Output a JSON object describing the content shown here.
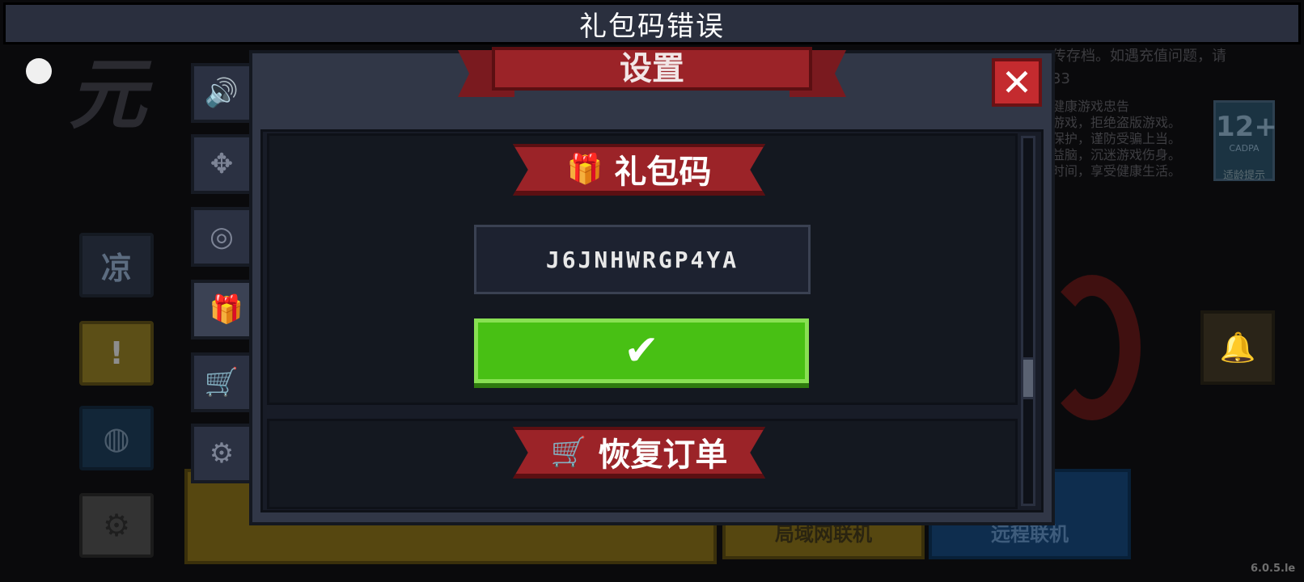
{
  "title_bar": {
    "text": "礼包码错误"
  },
  "dialog": {
    "header": "设置",
    "close_glyph": "✕",
    "gift_section": {
      "banner_label": "礼包码",
      "code_value": "J6JNHWRGP4YA",
      "confirm_glyph": "✔"
    },
    "restore_section": {
      "banner_label": "恢复订单"
    }
  },
  "tabs": [
    {
      "icon": "speaker-icon",
      "glyph": "🔊"
    },
    {
      "icon": "dpad-icon",
      "glyph": "✥"
    },
    {
      "icon": "globe-icon",
      "glyph": "◎"
    },
    {
      "icon": "gift-icon",
      "glyph": "🎁",
      "active": true
    },
    {
      "icon": "cart-icon",
      "glyph": "🛒"
    },
    {
      "icon": "settings-icon",
      "glyph": "⚙"
    }
  ],
  "background": {
    "side_buttons": [
      {
        "name": "cool",
        "label": "凉"
      },
      {
        "name": "warn",
        "label": "!"
      },
      {
        "name": "bird",
        "label": "◍"
      },
      {
        "name": "gear",
        "label": "⚙"
      }
    ],
    "multiplayer": {
      "lan_label": "局域网联机",
      "remote_label": "远程联机"
    },
    "notice_text": "传存档。如遇充值问题，请",
    "notice_text_2": "33",
    "health_notice": [
      "健康游戏忠告",
      "游戏，拒绝盗版游戏。",
      "保护，谨防受骗上当。",
      "益脑，沉迷游戏伤身。",
      "时间，享受健康生活。"
    ],
    "age_rating": {
      "number": "12+",
      "org": "CADPA",
      "label": "适龄提示"
    },
    "version": "6.0.5.le"
  },
  "colors": {
    "confirm_green": "#48c014",
    "ribbon_red": "#9b2328",
    "close_red": "#c42b2f",
    "panel": "#313747"
  }
}
